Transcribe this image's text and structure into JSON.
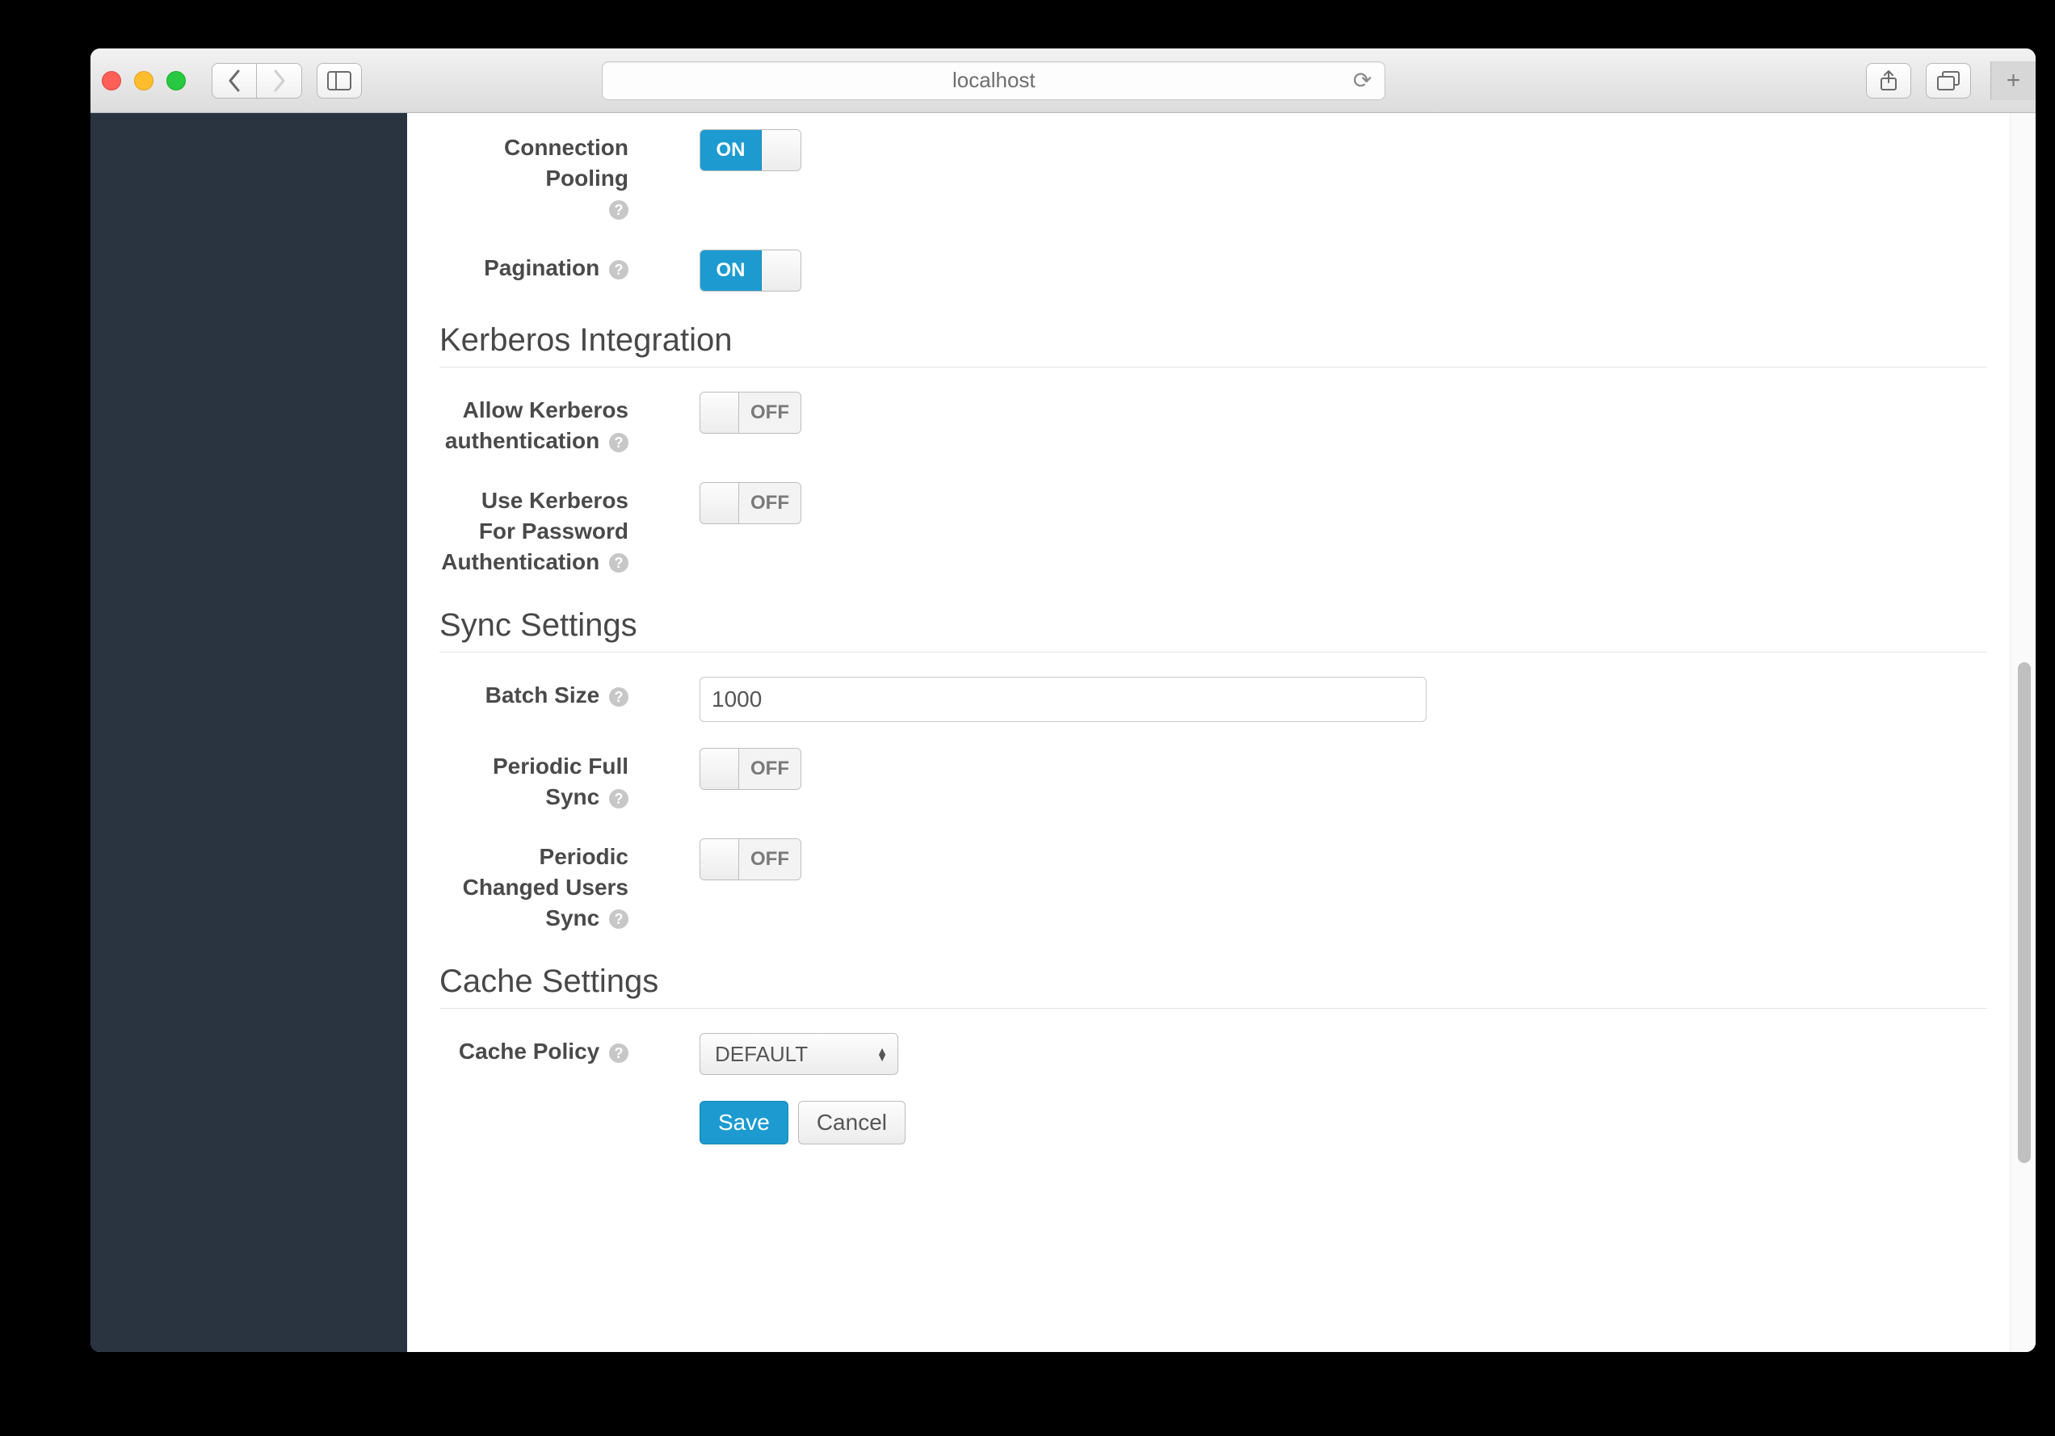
{
  "browser": {
    "url": "localhost"
  },
  "form": {
    "connection_pooling": {
      "label": "Connection Pooling",
      "state": "ON"
    },
    "pagination": {
      "label": "Pagination",
      "state": "ON"
    }
  },
  "sections": {
    "kerberos": {
      "title": "Kerberos Integration",
      "allow_auth": {
        "label": "Allow Kerberos authentication",
        "state": "OFF"
      },
      "use_for_password": {
        "label": "Use Kerberos For Password Authentication",
        "state": "OFF"
      }
    },
    "sync": {
      "title": "Sync Settings",
      "batch_size": {
        "label": "Batch Size",
        "value": "1000"
      },
      "periodic_full": {
        "label": "Periodic Full Sync",
        "state": "OFF"
      },
      "periodic_changed": {
        "label": "Periodic Changed Users Sync",
        "state": "OFF"
      }
    },
    "cache": {
      "title": "Cache Settings",
      "policy": {
        "label": "Cache Policy",
        "value": "DEFAULT"
      }
    }
  },
  "buttons": {
    "save": "Save",
    "cancel": "Cancel"
  }
}
